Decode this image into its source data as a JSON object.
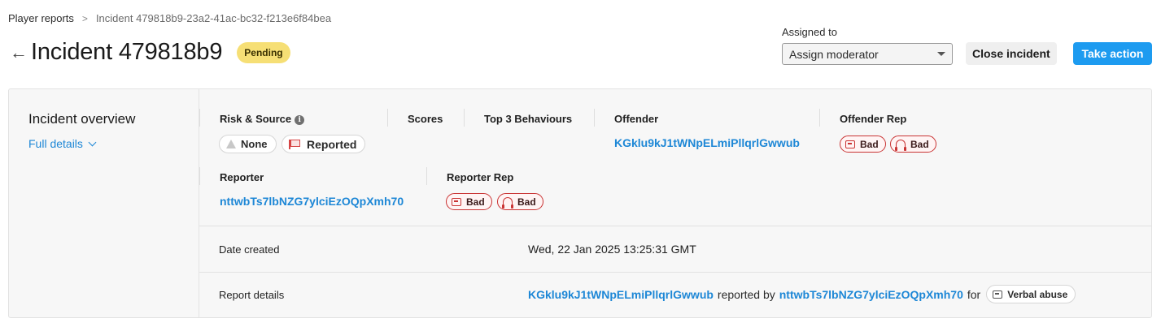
{
  "breadcrumb": {
    "parent": "Player reports",
    "separator": ">",
    "current": "Incident 479818b9-23a2-41ac-bc32-f213e6f84bea"
  },
  "header": {
    "back_icon": "arrow-left-icon",
    "title": "Incident 479818b9",
    "status": "Pending",
    "status_color": "#f6df75"
  },
  "assign": {
    "label": "Assigned to",
    "selected": "Assign moderator"
  },
  "actions": {
    "close_label": "Close incident",
    "take_action_label": "Take action",
    "accent_color": "#1d9bf0"
  },
  "overview": {
    "title": "Incident overview",
    "full_details": "Full details"
  },
  "risk_source": {
    "label": "Risk & Source",
    "risk": "None",
    "source": "Reported"
  },
  "scores": {
    "label": "Scores"
  },
  "behaviours": {
    "label": "Top 3 Behaviours"
  },
  "offender": {
    "label": "Offender",
    "id": "KGklu9kJ1tWNpELmiPllqrlGwwub"
  },
  "offender_rep": {
    "label": "Offender Rep",
    "chat": "Bad",
    "voice": "Bad"
  },
  "reporter": {
    "label": "Reporter",
    "id": "nttwbTs7lbNZG7ylciEzOQpXmh70"
  },
  "reporter_rep": {
    "label": "Reporter Rep",
    "chat": "Bad",
    "voice": "Bad"
  },
  "date_created": {
    "label": "Date created",
    "value": "Wed, 22 Jan 2025 13:25:31 GMT"
  },
  "report_details": {
    "label": "Report details",
    "offender": "KGklu9kJ1tWNpELmiPllqrlGwwub",
    "reported_by": "reported by",
    "reporter": "nttwbTs7lbNZG7ylciEzOQpXmh70",
    "for": "for",
    "category": "Verbal abuse"
  },
  "colors": {
    "link": "#1d87d6",
    "bad": "#c93434"
  }
}
